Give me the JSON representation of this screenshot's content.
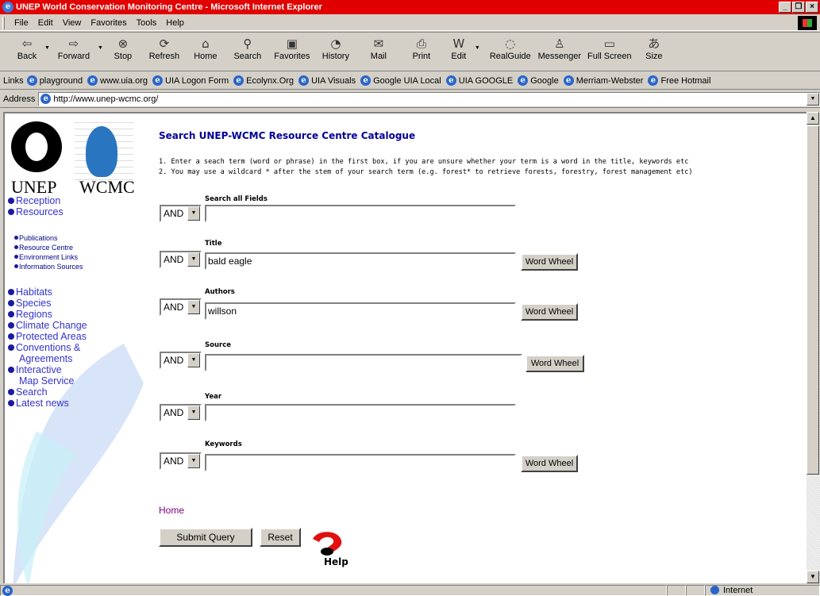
{
  "window": {
    "title": "UNEP World Conservation Monitoring Centre - Microsoft Internet Explorer",
    "controls": [
      "_",
      "×"
    ]
  },
  "menu": [
    "File",
    "Edit",
    "View",
    "Favorites",
    "Tools",
    "Help"
  ],
  "toolbar": [
    {
      "label": "Back",
      "icon": "back-arrow-icon"
    },
    {
      "label": "Forward",
      "icon": "forward-arrow-icon"
    },
    {
      "label": "Stop",
      "icon": "stop-icon"
    },
    {
      "label": "Refresh",
      "icon": "refresh-icon"
    },
    {
      "label": "Home",
      "icon": "home-icon"
    },
    {
      "label": "Search",
      "icon": "search-icon"
    },
    {
      "label": "Favorites",
      "icon": "favorites-icon"
    },
    {
      "label": "History",
      "icon": "history-icon"
    },
    {
      "label": "Mail",
      "icon": "mail-icon"
    },
    {
      "label": "Print",
      "icon": "print-icon"
    },
    {
      "label": "Edit",
      "icon": "edit-icon"
    },
    {
      "label": "RealGuide",
      "icon": "realguide-icon"
    },
    {
      "label": "Messenger",
      "icon": "messenger-icon"
    },
    {
      "label": "Full Screen",
      "icon": "fullscreen-icon"
    },
    {
      "label": "Size",
      "icon": "size-icon"
    }
  ],
  "links": {
    "label": "Links",
    "items": [
      "playground",
      "www.uia.org",
      "UIA Logon Form",
      "Ecolynx.Org",
      "UIA Visuals",
      "Google UIA Local",
      "UIA GOOGLE",
      "Google",
      "Merriam-Webster",
      "Free Hotmail"
    ]
  },
  "address": {
    "label": "Address",
    "url": "http://www.unep-wcmc.org/"
  },
  "logos": {
    "unep": "UNEP",
    "wcmc": "WCMC"
  },
  "nav_top": [
    "Reception",
    "Resources"
  ],
  "nav_sub": [
    "Publications",
    "Resource Centre",
    "Environment Links",
    "Information Sources"
  ],
  "nav_main": [
    "Habitats",
    "Species",
    "Regions",
    "Climate Change",
    "Protected Areas",
    "Conventions &",
    "Agreements",
    "Interactive",
    "Map Service",
    "Search",
    "Latest news"
  ],
  "page": {
    "title": "Search UNEP-WCMC Resource Centre Catalogue",
    "instr1": "1. Enter a seach term (word or phrase) in the first box, if you are unsure whether your term is a word in the title, keywords etc",
    "instr2": "2. You may use a wildcard * after the stem of your search term (e.g. forest* to retrieve forests, forestry, forest management etc)"
  },
  "fields": [
    {
      "label": "Search all Fields",
      "operator": "AND",
      "value": "",
      "word_wheel": ""
    },
    {
      "label": "Title",
      "operator": "AND",
      "value": "bald eagle",
      "word_wheel": "Word Wheel"
    },
    {
      "label": "Authors",
      "operator": "AND",
      "value": "willson",
      "word_wheel": "Word Wheel"
    },
    {
      "label": "Source",
      "operator": "AND",
      "value": "",
      "word_wheel": "Word Wheel"
    },
    {
      "label": "Year",
      "operator": "AND",
      "value": "",
      "word_wheel": ""
    },
    {
      "label": "Keywords",
      "operator": "AND",
      "value": "",
      "word_wheel": "Word Wheel"
    }
  ],
  "home_link": "Home",
  "buttons": {
    "submit": "Submit Query",
    "reset": "Reset",
    "help": "Help"
  },
  "status": {
    "zone": "Internet"
  }
}
